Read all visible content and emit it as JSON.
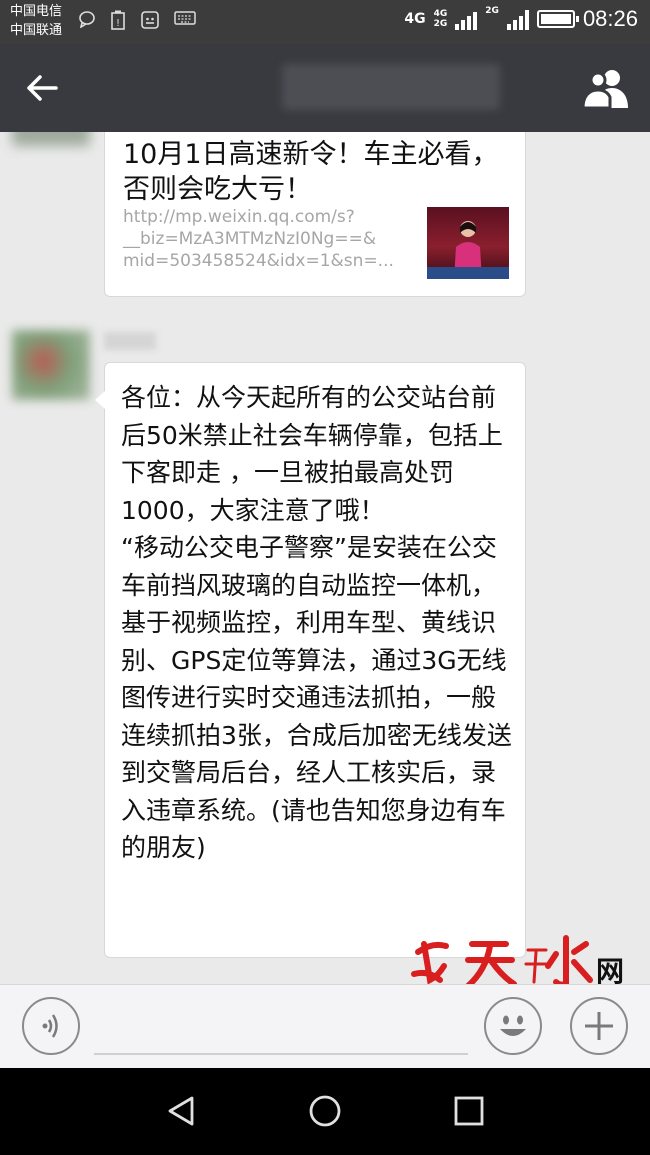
{
  "status_bar": {
    "carrier_1": "中国电信",
    "carrier_2": "中国联通",
    "network_primary": "4G",
    "network_secondary_top": "4G",
    "network_secondary_bottom": "2G",
    "network_tertiary": "2G",
    "time": "08:26",
    "battery_level": 1.0,
    "icons": [
      "chat-bubble-icon",
      "battery-warning-icon",
      "android-debug-icon",
      "keyboard-icon",
      "signal-icon",
      "battery-icon"
    ]
  },
  "header": {
    "back_icon": "arrow-left-icon",
    "title": "",
    "group_icon": "group-chat-icon"
  },
  "messages": {
    "link_card": {
      "title": "10月1日高速新令！车主必看，否则会吃大亏！",
      "url_line_1": "http://mp.weixin.qq.com/s?",
      "url_line_2": "__biz=MzA3MTMzNzI0Ng==&",
      "url_line_3": "mid=503458524&idx=1&sn=..."
    },
    "text_message": {
      "body": "各位：从今天起所有的公交站台前后50米禁止社会车辆停靠，包括上下客即走 ，一旦被拍最高处罚1000，大家注意了哦！\n“移动公交电子警察”是安装在公交车前挡风玻璃的自动监控一体机，基于视频监控，利用车型、黄线识别、GPS定位等算法，通过3G无线图传进行实时交通违法抓拍，一般连续抓拍3张，合成后加密无线发送到交警局后台，经人工核实后，录入违章系统。(请也告知您身边有车的朋友)"
    }
  },
  "watermark": {
    "text": "网"
  },
  "input_bar": {
    "voice_icon": "voice-input-icon",
    "emoji_icon": "emoji-icon",
    "plus_icon": "plus-icon"
  },
  "nav_bar": {
    "icons": [
      "back-triangle-icon",
      "home-circle-icon",
      "recents-square-icon"
    ]
  },
  "colors": {
    "status_bar": "#3c3c3c",
    "header": "#393a3f",
    "chat_background": "#eaeaea",
    "bubble": "#ffffff",
    "url_text": "#a6a6a6",
    "watermark_red": "#d81e1e"
  }
}
